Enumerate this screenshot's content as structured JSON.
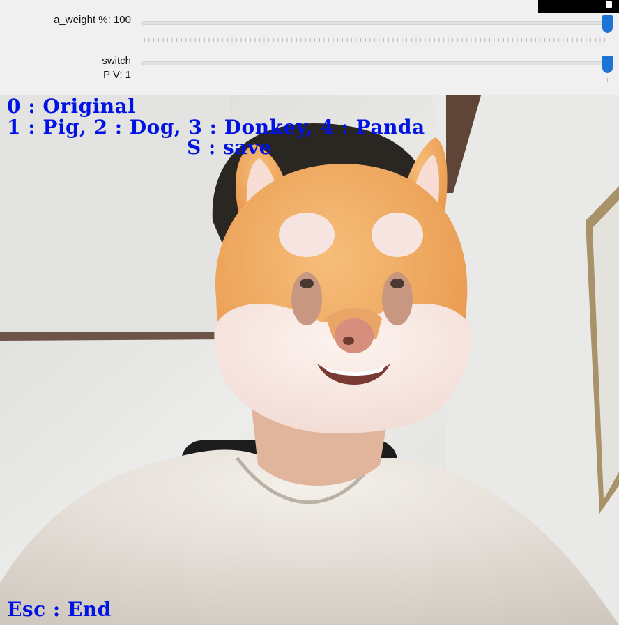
{
  "trackbars": {
    "weight_label": "a_weight %: 100",
    "switch_label": "switch",
    "switch_sublabel": "P V: 1"
  },
  "controls": {
    "weight_percent": 100,
    "switch_value": 1
  },
  "overlay": {
    "line_original": "0 : Original",
    "line_options": "1 : Pig, 2 : Dog, 3 : Donkey, 4 : Panda",
    "line_save": "S : save",
    "line_end": "Esc : End"
  },
  "colors": {
    "thumb": "#1e74d4",
    "overlay_text": "#0012e4",
    "mask_fur": "#f0a860",
    "mask_face": "#f7e6df"
  },
  "icons": {
    "corner": "window-control-icon"
  }
}
